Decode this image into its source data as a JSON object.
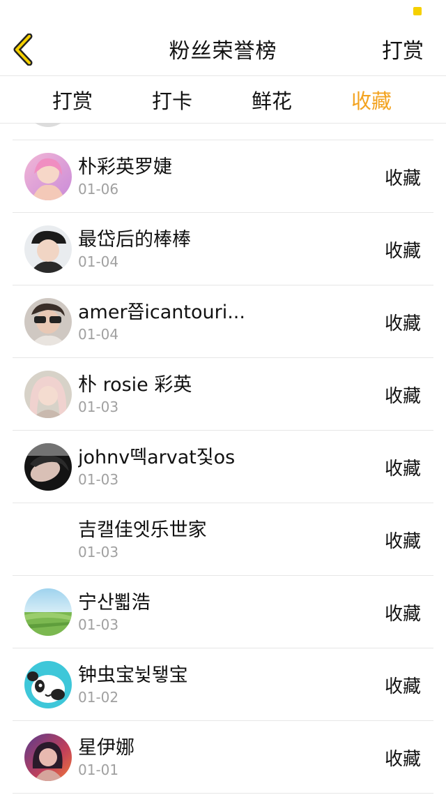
{
  "header": {
    "title": "粉丝荣誉榜",
    "right_action": "打赏",
    "back_icon": "chevron-left-icon",
    "accent_color": "#f3a320",
    "status_dot_color": "#f5d000"
  },
  "tabs": [
    {
      "label": "打赏",
      "active": false
    },
    {
      "label": "打卡",
      "active": false
    },
    {
      "label": "鲜花",
      "active": false
    },
    {
      "label": "收藏",
      "active": true
    }
  ],
  "list": {
    "items": [
      {
        "name": "朴彩英罗婕",
        "date": "01-06",
        "action": "收藏",
        "avatar": "avatar-pink-hair"
      },
      {
        "name": "最岱后的棒棒",
        "date": "01-04",
        "action": "收藏",
        "avatar": "avatar-cap"
      },
      {
        "name": "amer쯥icantouri...",
        "date": "01-04",
        "action": "收藏",
        "avatar": "avatar-sunglasses"
      },
      {
        "name": "朴 rosie 彩英",
        "date": "01-03",
        "action": "收藏",
        "avatar": "avatar-blonde"
      },
      {
        "name": "johnv떽arvat짗os",
        "date": "01-03",
        "action": "收藏",
        "avatar": "avatar-dark"
      },
      {
        "name": "吉캘佳엣乐世家",
        "date": "01-03",
        "action": "收藏",
        "avatar": "avatar-none"
      },
      {
        "name": "宁산뾟浩",
        "date": "01-03",
        "action": "收藏",
        "avatar": "avatar-landscape"
      },
      {
        "name": "钟虫宝뉯됗宝",
        "date": "01-02",
        "action": "收藏",
        "avatar": "avatar-cartoon-panda"
      },
      {
        "name": "星伊娜",
        "date": "01-01",
        "action": "收藏",
        "avatar": "avatar-red-light"
      }
    ]
  }
}
